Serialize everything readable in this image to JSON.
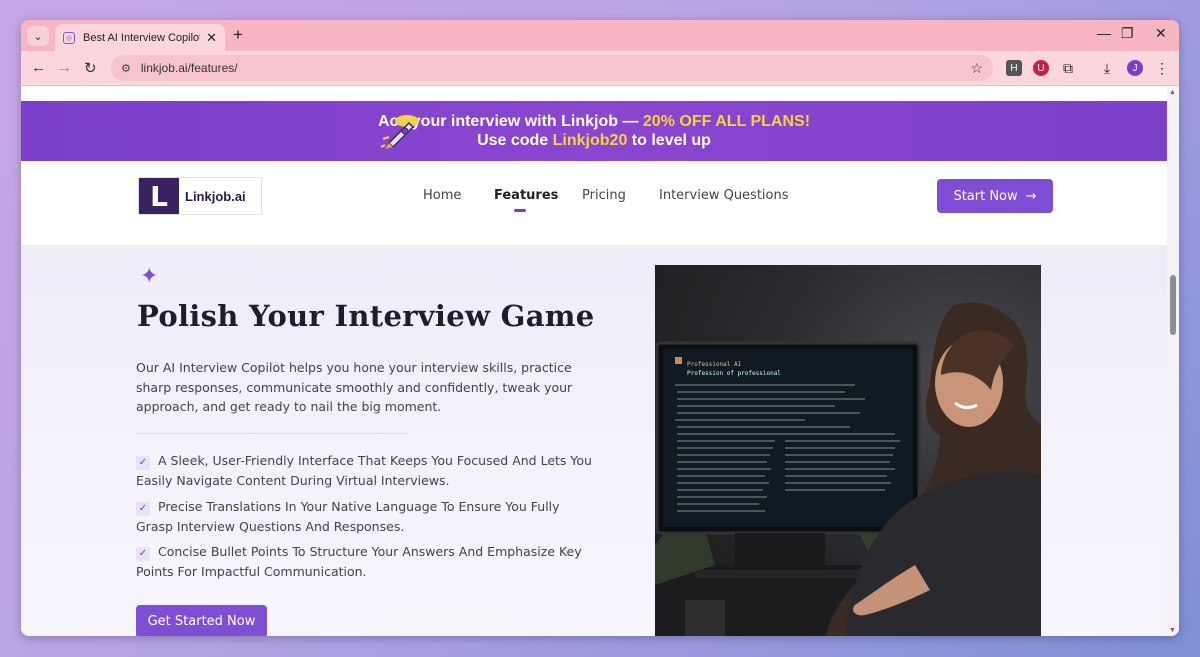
{
  "browser": {
    "tab_title": "Best AI Interview Copilot | Linkjo",
    "url": "linkjob.ai/features/",
    "profile_initial": "J",
    "ext_h_label": "H"
  },
  "promo": {
    "line1_prefix": "Ace your interview with Linkjob —",
    "line1_highlight": "20% OFF ALL PLANS!",
    "line2_prefix": "Use code",
    "line2_code": "Linkjob20",
    "line2_suffix": "to level up"
  },
  "nav": {
    "logo_mark": "L",
    "logo_text": "Linkjob.ai",
    "links": [
      "Home",
      "Features",
      "Pricing",
      "Interview Questions"
    ],
    "active": "Features",
    "start_label": "Start Now"
  },
  "hero": {
    "title": "Polish Your Interview Game",
    "description": "Our AI Interview Copilot helps you hone your interview skills, practice sharp responses, communicate smoothly and confidently, tweak your approach, and get ready to nail the big moment.",
    "features": [
      "A Sleek, User-Friendly Interface That Keeps You Focused And Lets You Easily Navigate Content During Virtual Interviews.",
      "Precise Translations In Your Native Language To Ensure You Fully Grasp Interview Questions And Responses.",
      "Concise Bullet Points To Structure Your Answers And Emphasize Key Points For Impactful Communication."
    ],
    "cta_label": "Get Started Now"
  },
  "monitor": {
    "header": "Professional AI",
    "subheader": "Profession of professional"
  },
  "colors": {
    "accent": "#7e4fd4",
    "promo_bg": "#7a3fc8",
    "promo_highlight": "#f9d23c",
    "tabstrip": "#f7b6c2"
  }
}
